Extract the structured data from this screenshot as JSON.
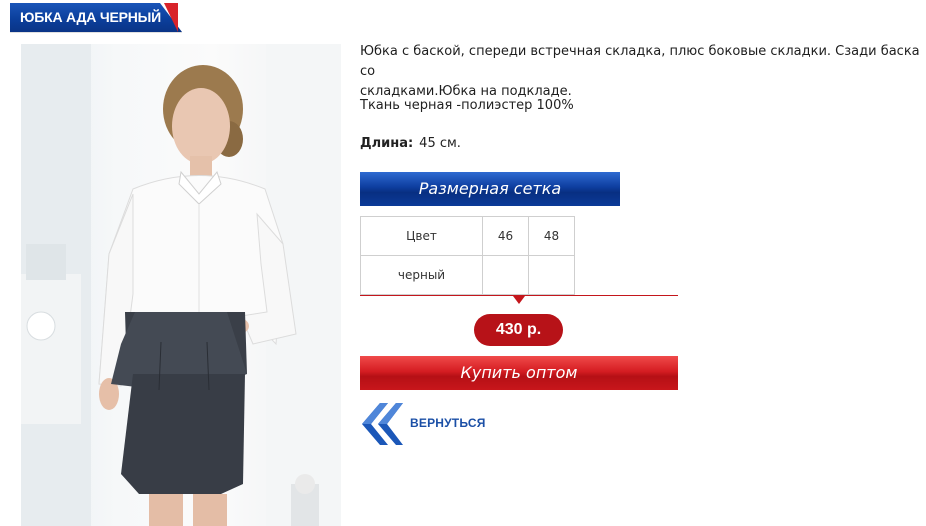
{
  "product": {
    "title": "ЮБКА АДА ЧЕРНЫЙ",
    "description_line1": "Юбка с баской, спереди встречная складка, плюс боковые складки. Сзади баска со",
    "description_line2": "складками.Юбка на подкладе.",
    "fabric": "Ткань черная -полиэстер 100%",
    "length_label": "Длина:",
    "length_value": "45 см."
  },
  "size_chart": {
    "button_label": "Размерная сетка",
    "header": [
      "Цвет",
      "46",
      "48"
    ],
    "rows": [
      [
        "черный",
        "",
        ""
      ]
    ]
  },
  "price": "430 р.",
  "buy_button_label": "Купить оптом",
  "back_link_label": "ВЕРНУТЬСЯ",
  "colors": {
    "brand_blue": "#0b3f9c",
    "brand_red": "#c4161c",
    "price_red": "#b71218",
    "link_blue": "#1b4fa6"
  },
  "icons": {
    "back": "double-chevron-left-icon"
  }
}
